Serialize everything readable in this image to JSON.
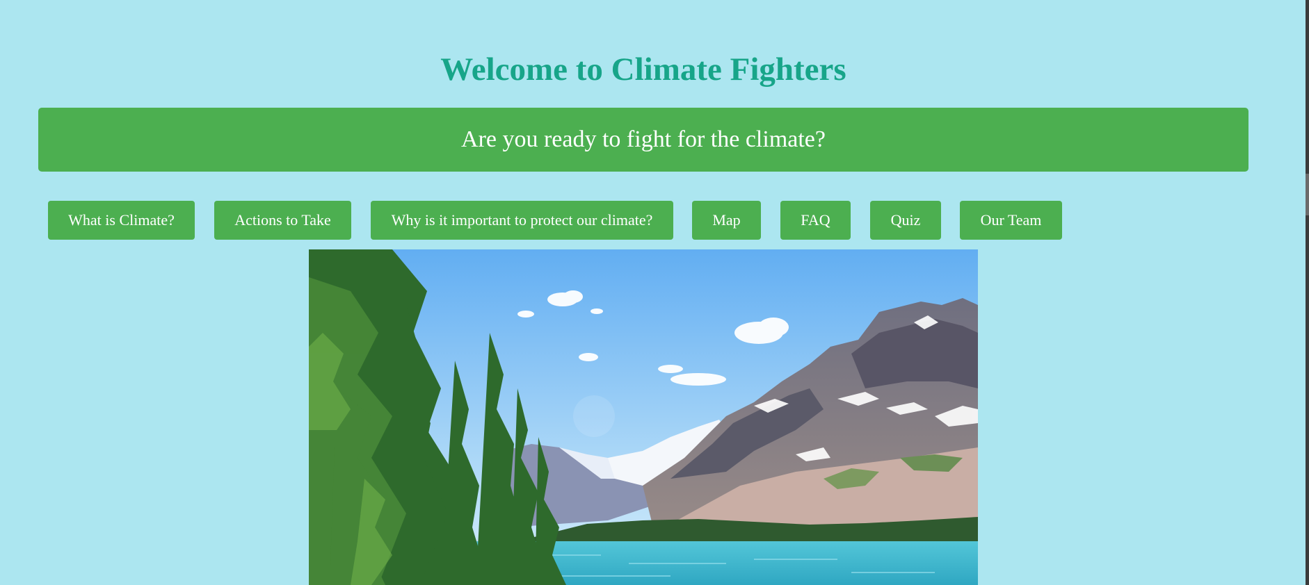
{
  "header": {
    "title": "Welcome to Climate Fighters"
  },
  "banner": {
    "text": "Are you ready to fight for the climate?"
  },
  "nav": {
    "items": [
      {
        "label": "What is Climate?"
      },
      {
        "label": "Actions to Take"
      },
      {
        "label": "Why is it important to protect our climate?"
      },
      {
        "label": "Map"
      },
      {
        "label": "FAQ"
      },
      {
        "label": "Quiz"
      },
      {
        "label": "Our Team"
      }
    ]
  },
  "hero": {
    "subject": "mountain-lake-landscape"
  },
  "colors": {
    "page_background": "#ace6f0",
    "title_text": "#17a589",
    "accent_green": "#4caf50",
    "button_text": "#ffffff"
  }
}
